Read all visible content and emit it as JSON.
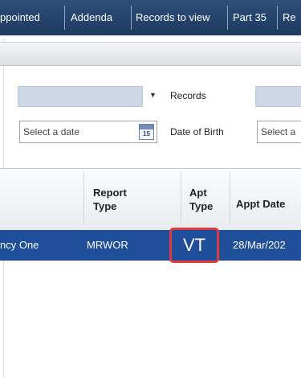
{
  "nav": {
    "tabs": [
      {
        "label": "ppointed"
      },
      {
        "label": "Addenda"
      },
      {
        "label": "Records to view"
      },
      {
        "label": "Part 35"
      },
      {
        "label": "Re"
      }
    ]
  },
  "filters": {
    "records_label": "Records",
    "date_placeholder": "Select a date",
    "dob_label": "Date of Birth",
    "date2_placeholder": "Select a",
    "calendar_icon_text": "15"
  },
  "grid": {
    "columns": [
      {
        "line1": "Report",
        "line2": "Type"
      },
      {
        "line1": "Apt",
        "line2": "Type"
      },
      {
        "line1": "Appt Date",
        "line2": ""
      }
    ],
    "row": {
      "name": "ncy One",
      "report_type": "MRWOR",
      "apt_type": "VT",
      "appt_date": "28/Mar/202"
    }
  },
  "colors": {
    "nav_bg": "#1e3a60",
    "selected_row": "#1f4e9a",
    "highlight_border": "#e23a3a"
  }
}
